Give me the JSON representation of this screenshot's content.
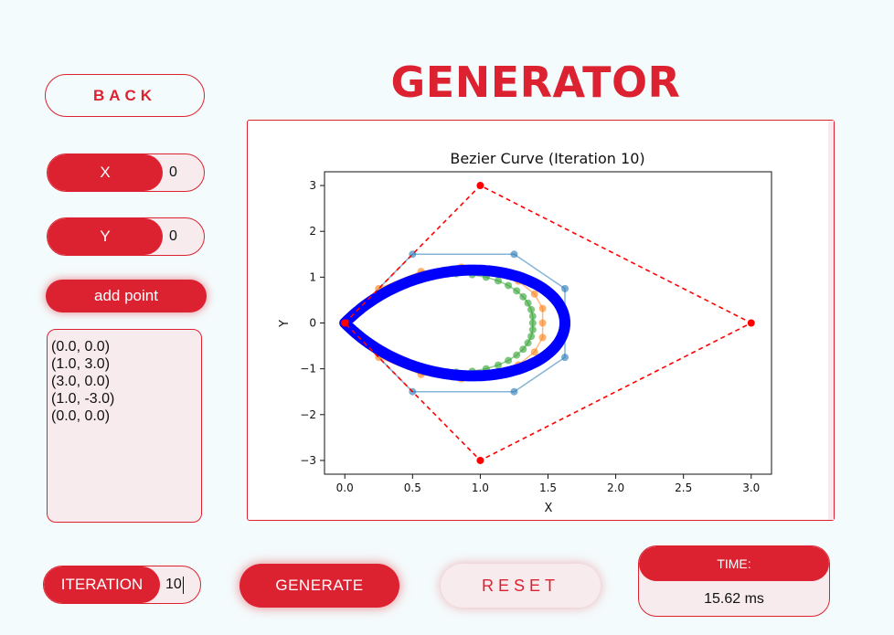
{
  "app": {
    "title": "GENERATOR",
    "back_label": "BACK"
  },
  "inputs": {
    "x_label": "X",
    "x_value": "0",
    "y_label": "Y",
    "y_value": "0",
    "add_point_label": "add point"
  },
  "points_list": [
    "(0.0, 0.0)",
    "(1.0, 3.0)",
    "(3.0, 0.0)",
    "(1.0, -3.0)",
    "(0.0, 0.0)"
  ],
  "controls": {
    "iteration_label": "ITERATION",
    "iteration_value": "10",
    "generate_label": "GENERATE",
    "reset_label": "RESET"
  },
  "time": {
    "label": "TIME:",
    "value": "15.62 ms"
  },
  "colors": {
    "accent": "#dc2230",
    "panel": "#f7ebee",
    "background": "#f4fbfc",
    "control_polygon": "#ff0000",
    "curve": "#0000ff",
    "construction_1": "#1f77b4",
    "construction_2": "#ff7f0e",
    "construction_3": "#2ca02c"
  },
  "chart_data": {
    "type": "line",
    "title": "Bezier Curve (Iteration 10)",
    "xlabel": "X",
    "ylabel": "Y",
    "xlim": [
      -0.15,
      3.15
    ],
    "ylim": [
      -3.3,
      3.3
    ],
    "xticks": [
      "0.0",
      "0.5",
      "1.0",
      "1.5",
      "2.0",
      "2.5",
      "3.0"
    ],
    "yticks": [
      "3",
      "2",
      "1",
      "0",
      "−1",
      "−2",
      "−3"
    ],
    "grid": false,
    "control_points": [
      [
        0.0,
        0.0
      ],
      [
        1.0,
        3.0
      ],
      [
        3.0,
        0.0
      ],
      [
        1.0,
        -3.0
      ],
      [
        0.0,
        0.0
      ]
    ],
    "iterations": 10
  }
}
